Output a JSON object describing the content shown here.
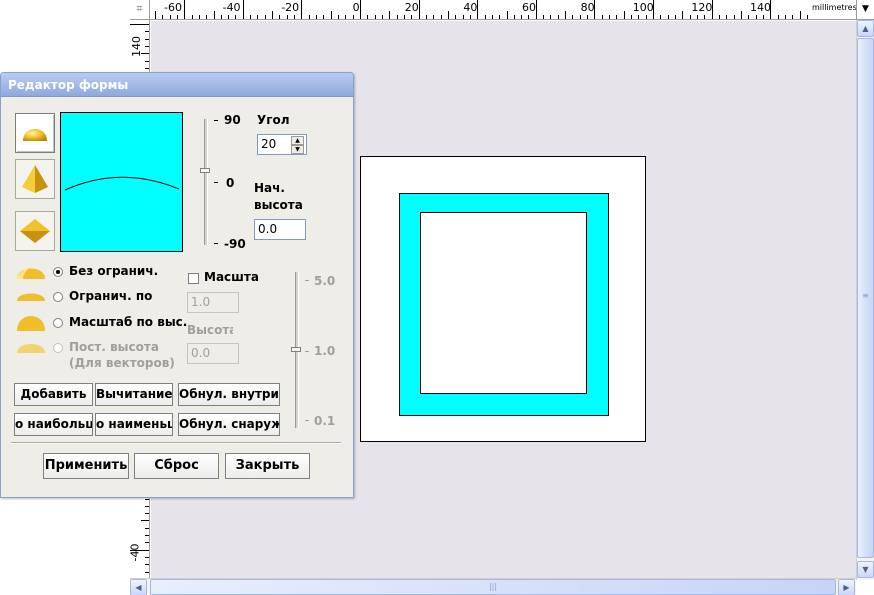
{
  "ruler": {
    "h_labels": [
      "-60",
      "-40",
      "-20",
      "0",
      "20",
      "40",
      "60",
      "80",
      "100",
      "120",
      "140"
    ],
    "v_labels": [
      "140",
      "-40"
    ],
    "units": "millimetres",
    "corner_glyph": "⌗"
  },
  "dialog": {
    "title": "Редактор формы",
    "shapes": [
      {
        "icon": "dome-shape-icon",
        "active": true
      },
      {
        "icon": "pyramid-shape-icon",
        "active": false
      },
      {
        "icon": "diamond-shape-icon",
        "active": false
      }
    ],
    "angle_slider": {
      "top_label": "90",
      "mid_label": "0",
      "bottom_label": "-90"
    },
    "angle_label": "Угол",
    "angle_value": "20",
    "start_height_label": "Нач.\nвысота",
    "start_height_label_line1": "Нач.",
    "start_height_label_line2": "высота",
    "start_height_value": "0.0",
    "options": [
      {
        "label": "Без огранич.",
        "checked": true,
        "bold": true,
        "disabled": false
      },
      {
        "label": "Огранич. по",
        "checked": false,
        "bold": true,
        "disabled": false
      },
      {
        "label": "Масштаб по выс.",
        "checked": false,
        "bold": true,
        "disabled": false
      },
      {
        "label": "Пост. высота",
        "sublabel": "(Для векторов)",
        "checked": false,
        "bold": true,
        "disabled": true
      }
    ],
    "scale_checkbox_label": "Масшта",
    "scale_value": "1.0",
    "height_label": "Высота",
    "height_value": "0.0",
    "scale_slider": {
      "top_label": "5.0",
      "mid_label": "1.0",
      "bottom_label": "0.1"
    },
    "buttons_row1": [
      "Добавить",
      "Вычитание",
      "Обнул. внутри"
    ],
    "buttons_row2": [
      "о наибольш",
      "о наименьш",
      "Обнул. снаружи"
    ],
    "apply_label": "Применить",
    "reset_label": "Сброс",
    "close_label": "Закрыть"
  },
  "colors": {
    "accent_cyan": "#00ffff",
    "canvas_bg": "#e6e4ea",
    "dialog_bg": "#eeede8",
    "titlebar": "#8fa9de"
  }
}
